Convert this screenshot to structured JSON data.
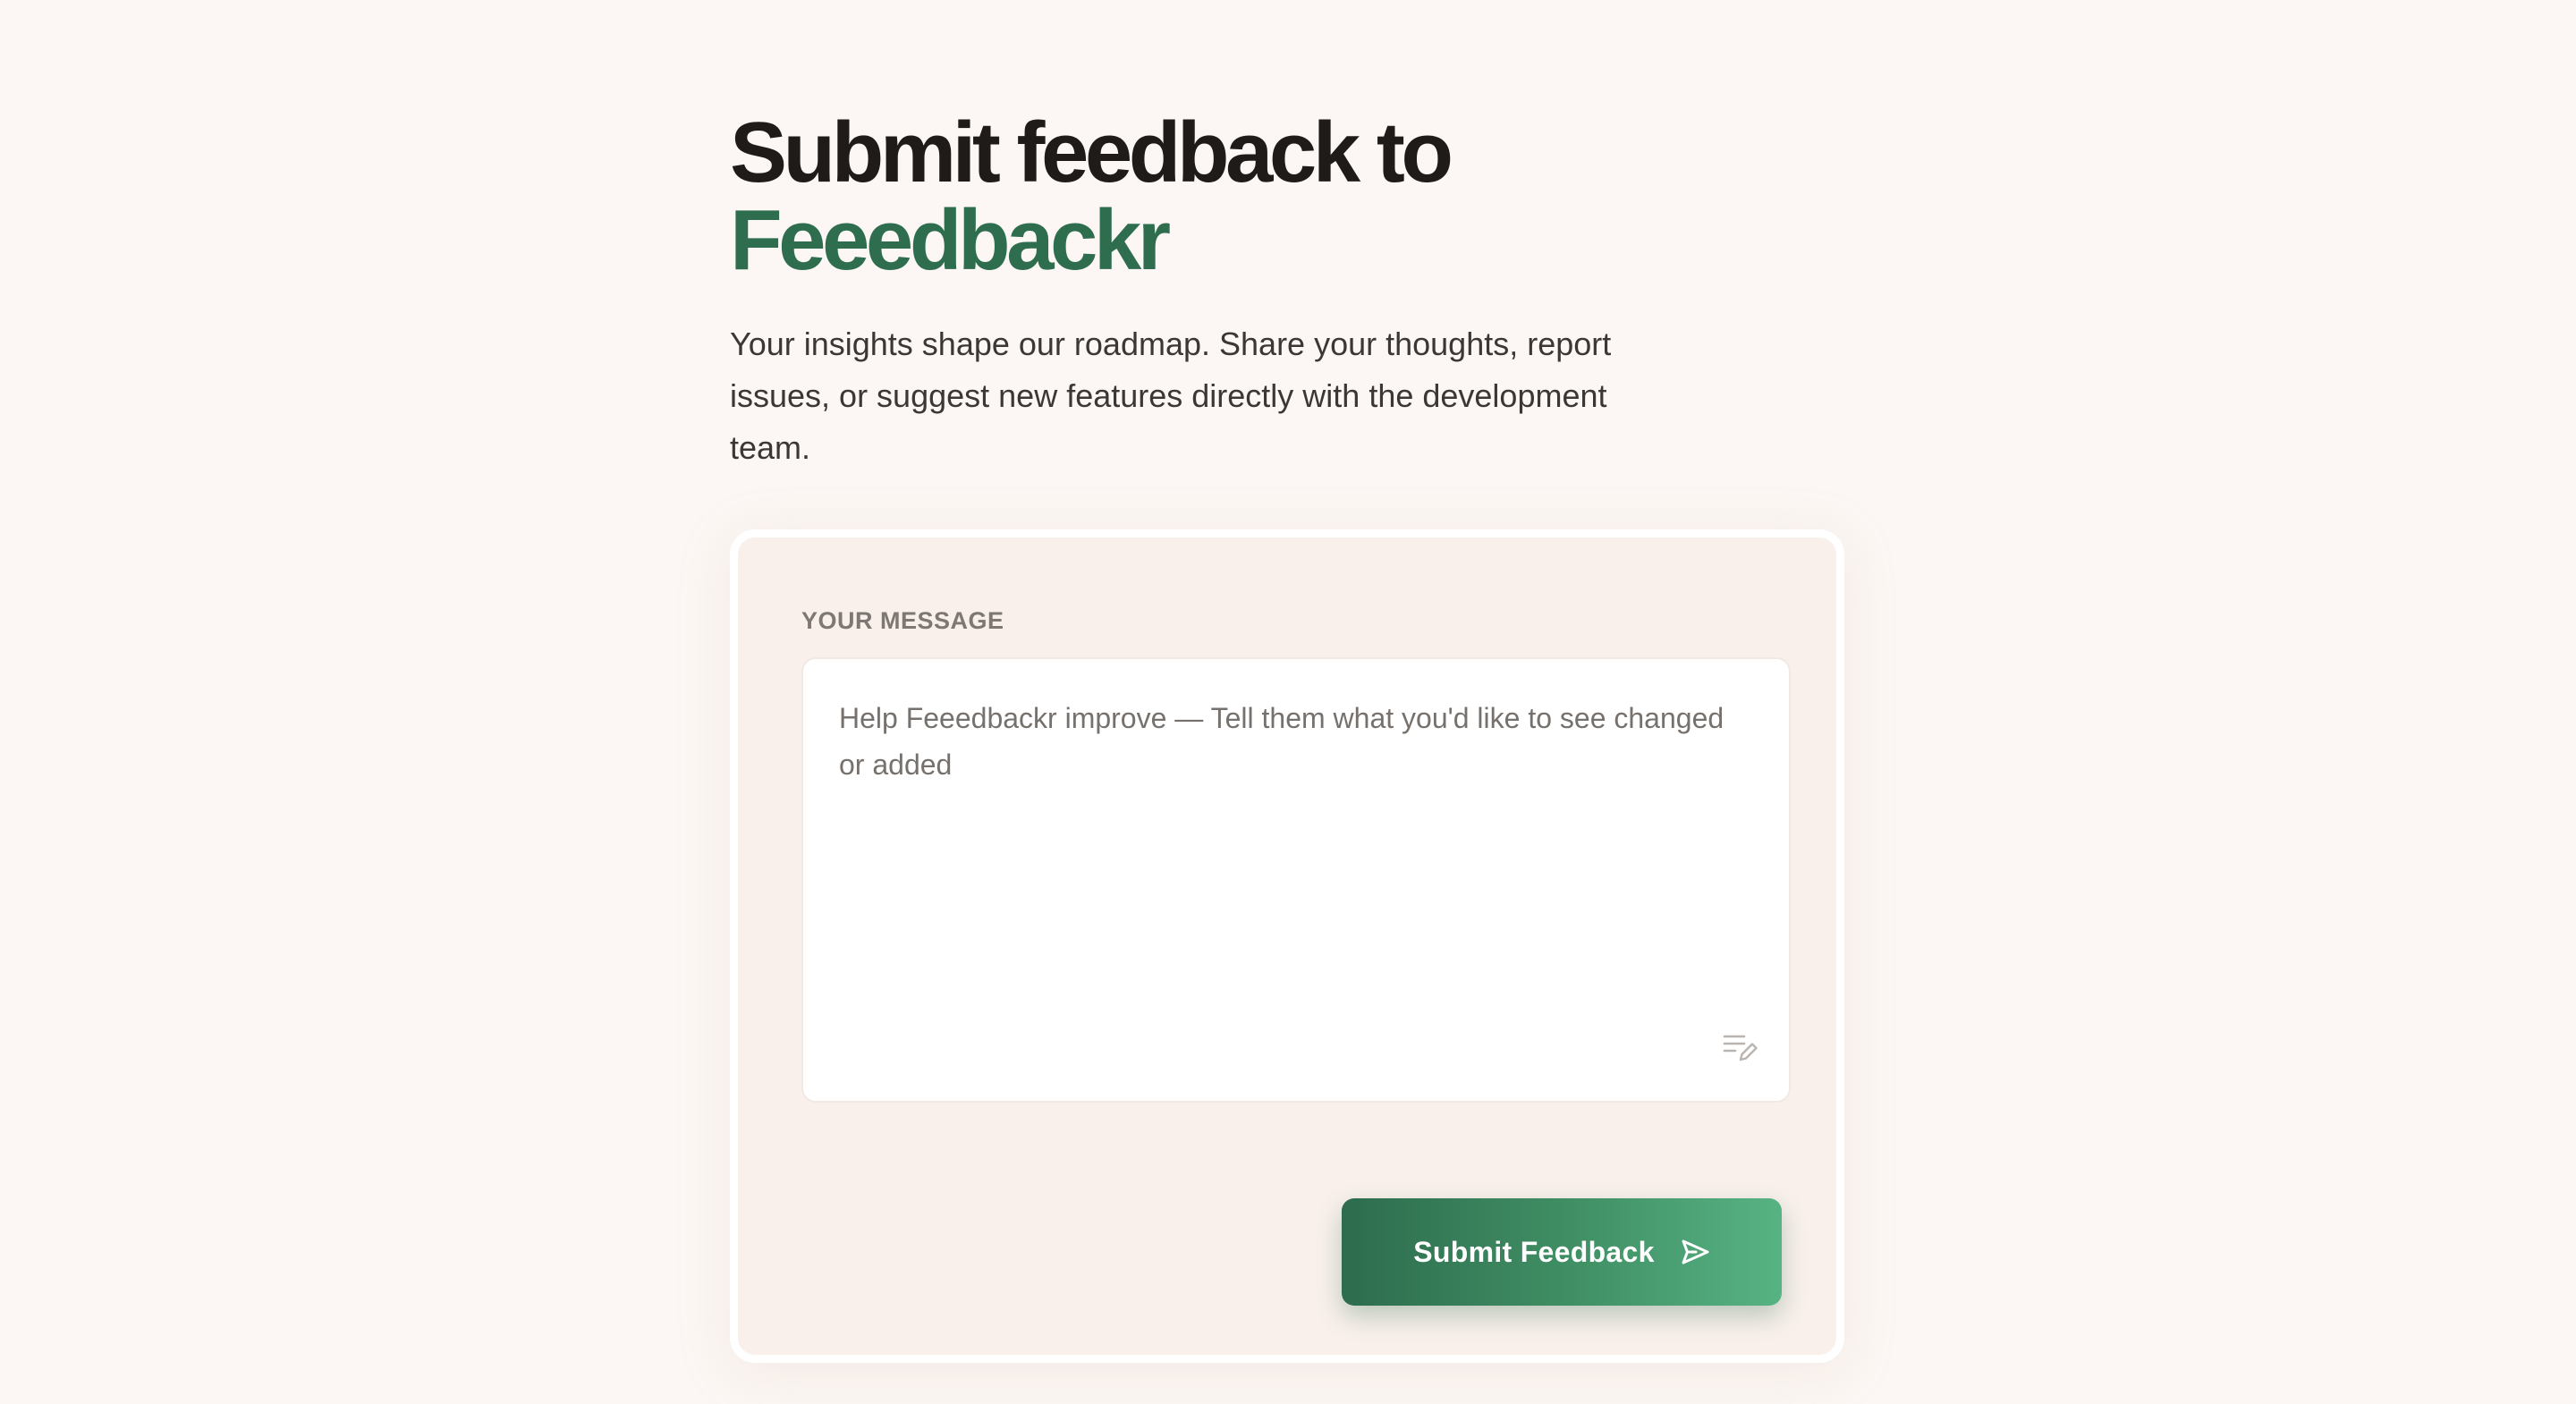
{
  "header": {
    "title_prefix": "Submit feedback to",
    "title_brand": "Feeedbackr",
    "subtitle": "Your insights shape our roadmap. Share your thoughts, report issues, or suggest new features directly with the development team."
  },
  "form": {
    "message_label": "YOUR MESSAGE",
    "message_placeholder": "Help Feeedbackr improve — Tell them what you'd like to see changed or added",
    "message_value": "",
    "submit_label": "Submit Feedback"
  },
  "icons": {
    "textarea_corner": "edit-note-icon",
    "submit": "send-icon"
  },
  "colors": {
    "background": "#fcf7f4",
    "brand": "#2e6e4f",
    "button_gradient_start": "#2d6c4e",
    "button_gradient_end": "#57b383"
  }
}
